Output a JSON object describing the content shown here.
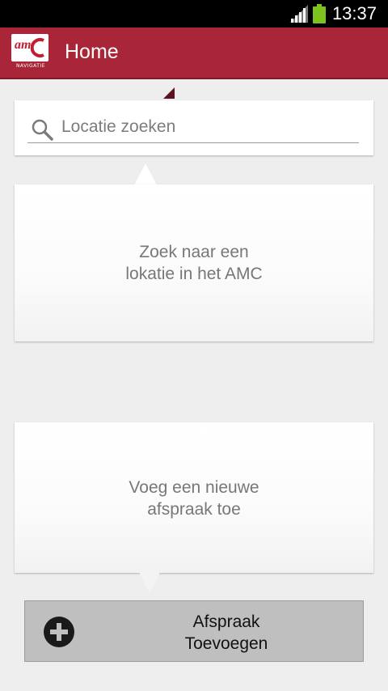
{
  "status_bar": {
    "time": "13:37"
  },
  "action_bar": {
    "logo_text": "am",
    "logo_subtitle": "NAVIGATIE",
    "title": "Home"
  },
  "search": {
    "placeholder": "Locatie zoeken"
  },
  "cards": {
    "search_hint": [
      "Zoek naar een",
      "lokatie in het AMC"
    ],
    "appointment_hint": [
      "Voeg een nieuwe",
      "afspraak toe"
    ]
  },
  "add_button": {
    "label_line1": "Afspraak",
    "label_line2": "Toevoegen"
  },
  "colors": {
    "accent": "#a82638",
    "background": "#efeeee",
    "button": "#bfbfbf"
  },
  "icons": {
    "signal": "signal-icon",
    "battery": "battery-icon",
    "search": "search-icon",
    "add": "plus-circle-icon"
  }
}
